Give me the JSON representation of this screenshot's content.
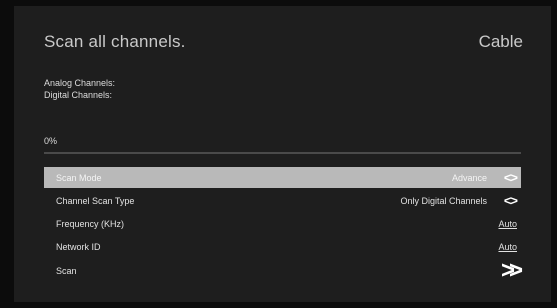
{
  "header": {
    "title": "Scan all channels.",
    "source": "Cable"
  },
  "status": {
    "analog_label": "Analog Channels:",
    "digital_label": "Digital Channels:"
  },
  "progress": {
    "percent_text": "0%",
    "value": 0
  },
  "menu": {
    "items": [
      {
        "label": "Scan Mode",
        "value": "Advance",
        "control": "<>"
      },
      {
        "label": "Channel Scan Type",
        "value": "Only Digital Channels",
        "control": "<>"
      },
      {
        "label": "Frequency (KHz)",
        "value": "Auto"
      },
      {
        "label": "Network ID",
        "value": "Auto"
      },
      {
        "label": "Scan",
        "control": ">>"
      }
    ]
  },
  "colors": {
    "background": "#1e1e1e",
    "selected_row": "#b9b9b9",
    "text": "#e2e2e2"
  }
}
